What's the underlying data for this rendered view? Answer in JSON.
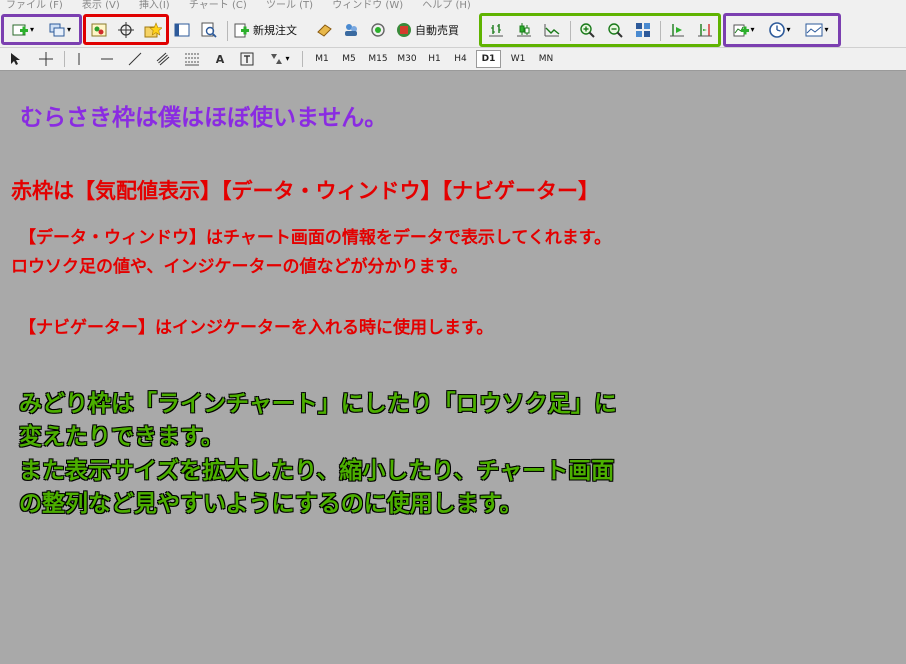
{
  "menu": [
    "ファイル (F)",
    "表示 (V)",
    "挿入(I)",
    "チャート (C)",
    "ツール (T)",
    "ウィンドウ (W)",
    "ヘルプ (H)"
  ],
  "toolbar": {
    "new_order": "新規注文",
    "auto_trade": "自動売買"
  },
  "timeframes": [
    {
      "label": "M1",
      "active": false
    },
    {
      "label": "M5",
      "active": false
    },
    {
      "label": "M15",
      "active": false
    },
    {
      "label": "M30",
      "active": false
    },
    {
      "label": "H1",
      "active": false
    },
    {
      "label": "H4",
      "active": false
    },
    {
      "label": "D1",
      "active": true
    },
    {
      "label": "W1",
      "active": false
    },
    {
      "label": "MN",
      "active": false
    }
  ],
  "frame_colors": {
    "purple": "#7b3fb0",
    "red": "#e00000",
    "green": "#5fb300"
  },
  "content": {
    "purple_note": "むらさき枠は僕はほぼ使いません。",
    "red_heading": "赤枠は【気配値表示】【データ・ウィンドウ】【ナビゲーター】",
    "red_line1": "【データ・ウィンドウ】はチャート画面の情報をデータで表示してくれます。",
    "red_line2": "ロウソク足の値や、インジケーターの値などが分かります。",
    "red_line3": "【ナビゲーター】はインジケーターを入れる時に使用します。",
    "green_line1": "みどり枠は「ラインチャート」にしたり「ロウソク足」に",
    "green_line2": "変えたりできます。",
    "green_line3": "また表示サイズを拡大したり、縮小したり、チャート画面",
    "green_line4": "の整列など見やすいようにするのに使用します。"
  }
}
